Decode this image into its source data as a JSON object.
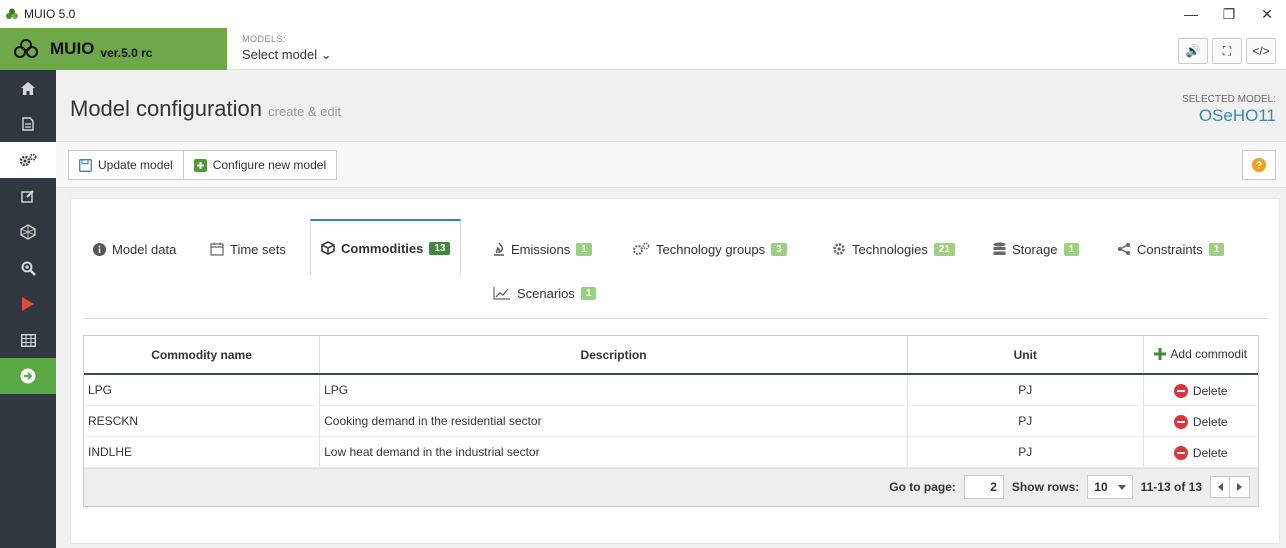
{
  "window": {
    "title": "MUIO 5.0",
    "minimize": "—",
    "maximize": "❐",
    "close": "✕"
  },
  "brand": {
    "name": "MUIO",
    "version": "ver.5.0 rc"
  },
  "models": {
    "label": "MODELS:",
    "selected": "Select model ⌄"
  },
  "header_tools": {
    "sound": "🔊",
    "fullscreen": "⛶",
    "code": "</>"
  },
  "page": {
    "title": "Model configuration",
    "subtitle": "create & edit",
    "selected_label": "SELECTED MODEL:",
    "selected_value": "OSeHO11"
  },
  "toolbar": {
    "update": "Update model",
    "configure": "Configure new model"
  },
  "tabs": [
    {
      "label": "Model data",
      "badge": ""
    },
    {
      "label": "Time sets",
      "badge": ""
    },
    {
      "label": "Commodities",
      "badge": "13"
    },
    {
      "label": "Emissions",
      "badge": "1"
    },
    {
      "label": "Technology groups",
      "badge": "3"
    },
    {
      "label": "Technologies",
      "badge": "21"
    },
    {
      "label": "Storage",
      "badge": "1"
    },
    {
      "label": "Constraints",
      "badge": "1"
    },
    {
      "label": "Scenarios",
      "badge": "1"
    }
  ],
  "grid": {
    "columns": [
      "Commodity name",
      "Description",
      "Unit",
      "Add commodit"
    ],
    "rows": [
      {
        "name": "LPG",
        "description": "LPG",
        "unit": "PJ",
        "action": "Delete"
      },
      {
        "name": "RESCKN",
        "description": "Cooking demand in the residential sector",
        "unit": "PJ",
        "action": "Delete"
      },
      {
        "name": "INDLHE",
        "description": "Low heat demand in the industrial sector",
        "unit": "PJ",
        "action": "Delete"
      }
    ],
    "footer": {
      "goto_label": "Go to page:",
      "goto_value": "2",
      "rows_label": "Show rows:",
      "rows_value": "10",
      "range": "11-13 of 13"
    }
  },
  "colors": {
    "brand_green": "#6fa84a",
    "sidebar_bg": "#31373e",
    "accent_blue": "#3a87ad",
    "badge_green": "#9ccf7f",
    "delete_red": "#d9363e"
  }
}
